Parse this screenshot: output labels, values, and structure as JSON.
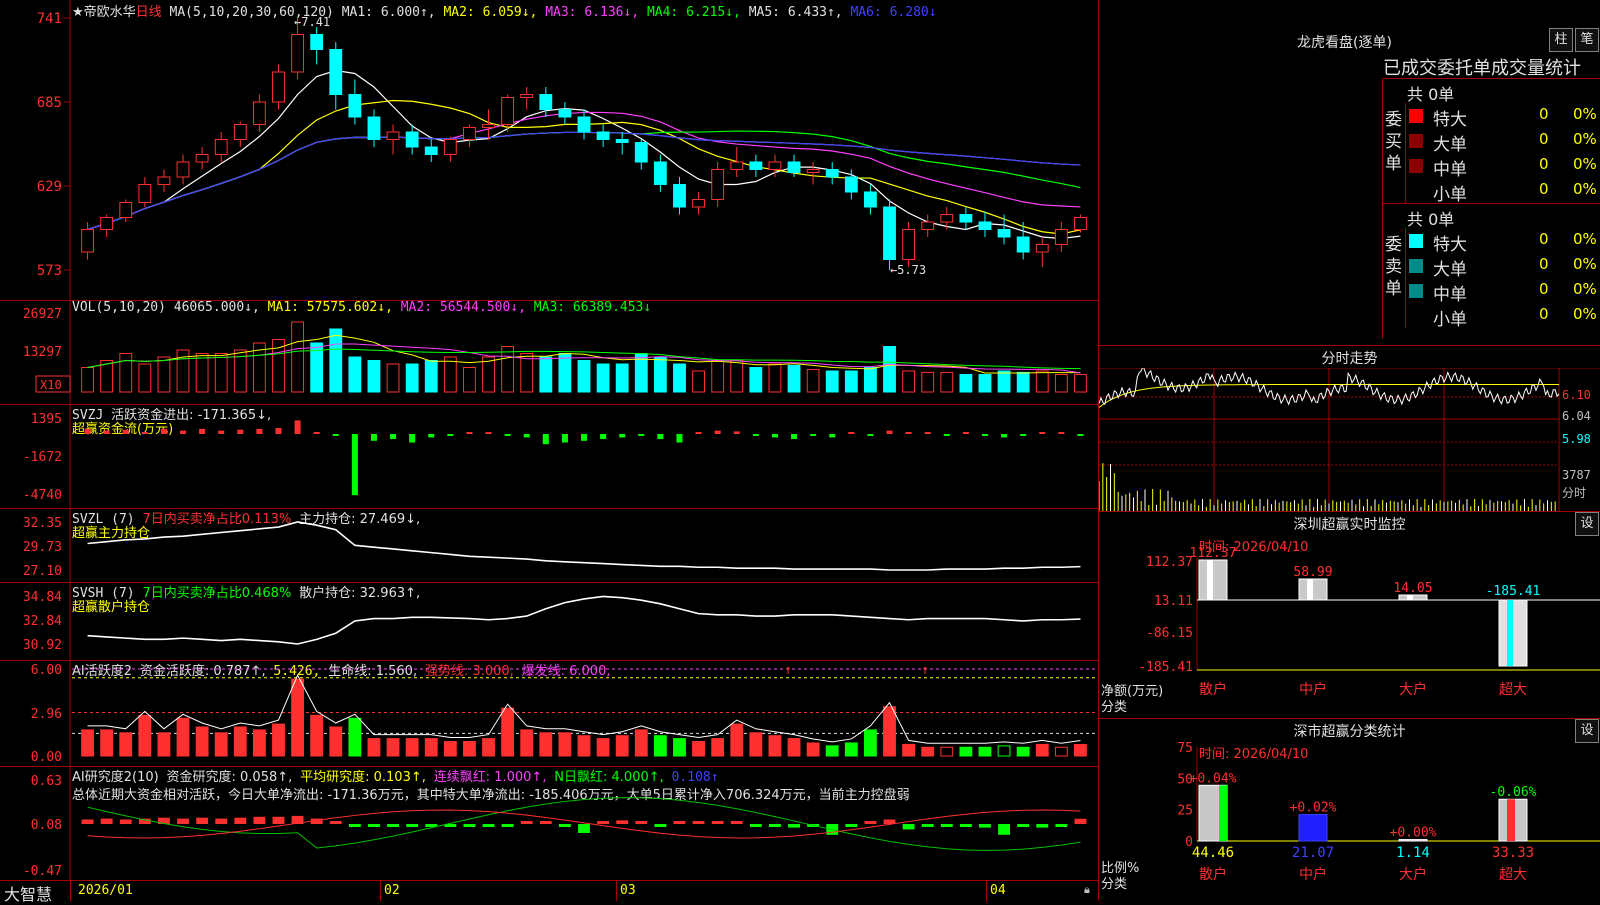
{
  "stock": {
    "name": "★帝欧水华",
    "period": "日线",
    "ma_text": "MA(5,10,20,30,60,120)",
    "ma1": "MA1: 6.000↑,",
    "ma2": "MA2: 6.059↓,",
    "ma3": "MA3: 6.136↓,",
    "ma4": "MA4: 6.215↓,",
    "ma5": "MA5: 6.433↑,",
    "ma6": "MA6: 6.280↓",
    "y_labels": [
      "7.41",
      "6.85",
      "6.29",
      "5.73"
    ],
    "high_label": "7.41",
    "low_label": "5.73"
  },
  "vol": {
    "title": "VOL(5,10,20)",
    "value": "46065.000↓,",
    "ma1": "MA1: 57575.602↓,",
    "ma2": "MA2: 56544.500↓,",
    "ma3": "MA3: 66389.453↓",
    "y_labels": [
      "26927",
      "13297"
    ],
    "unit": "X10"
  },
  "svzj": {
    "title": "SVZJ",
    "label": "活跃资金进出: -171.365↓,",
    "sub": "超赢资金流(万元)",
    "y_labels": [
      "1395",
      "-1672",
      "-4740"
    ]
  },
  "svzl": {
    "title": "SVZL (7)",
    "ratio": "7日内买卖净占比0.113%",
    "hold": "主力持仓: 27.469↓,",
    "sub": "超赢主力持仓",
    "y_labels": [
      "32.35",
      "29.73",
      "27.10"
    ]
  },
  "svsh": {
    "title": "SVSH (7)",
    "ratio": "7日内买卖净占比0.468%",
    "hold": "散户持仓: 32.963↑,",
    "sub": "超赢散户持仓",
    "y_labels": [
      "34.84",
      "32.84",
      "30.92"
    ]
  },
  "ai1": {
    "title": "AI活跃度2",
    "activity": "资金活跃度: 0.787↑,",
    "extra": "5.426,",
    "life": "生命线: 1.560,",
    "strong": "强势线: 3.000,",
    "burst": "爆发线: 6.000,",
    "y_labels": [
      "6.00",
      "2.96",
      "0.00"
    ]
  },
  "ai2": {
    "title": "AI研究度2(10)",
    "research": "资金研究度: 0.058↑,",
    "avg": "平均研究度: 0.103↑,",
    "streak": "连续飘红: 1.000↑,",
    "nday": "N日飘红: 4.000↑,",
    "last": "0.108↑",
    "summary": "总体近期大资金相对活跃，今日大单净流出: -171.36万元，其中特大单净流出: -185.406万元，大单5日累计净入706.324万元，当前主力控盘弱",
    "y_labels": [
      "0.63",
      "0.08",
      "-0.47"
    ]
  },
  "xaxis": {
    "logo": "大智慧",
    "labels": [
      "2026/01",
      "02",
      "03",
      "04"
    ]
  },
  "longhu": {
    "title": "龙虎看盘(逐单)",
    "btn1": "柱",
    "btn2": "笔",
    "subtitle": "已成交委托单成交量统计",
    "buy_label": "委买单",
    "sell_label": "委卖单",
    "buy_total": "共 0单",
    "sell_total": "共 0单",
    "rows": [
      {
        "name": "特大",
        "count": "0",
        "pct": "0%"
      },
      {
        "name": "大单",
        "count": "0",
        "pct": "0%"
      },
      {
        "name": "中单",
        "count": "0",
        "pct": "0%"
      },
      {
        "name": "小单",
        "count": "0",
        "pct": "0%"
      }
    ]
  },
  "fenshi": {
    "title": "分时走势",
    "y_labels": [
      "6.10",
      "6.04",
      "5.98"
    ],
    "vol_label": "3787",
    "vol_unit": "分时"
  },
  "monitor": {
    "title": "深圳超赢实时监控",
    "btn": "设",
    "time": "时间: 2026/04/10",
    "y_labels": [
      "112.37",
      "13.11",
      "-86.15",
      "-185.41"
    ],
    "unit_label": "净额(万元)",
    "cat_label": "分类",
    "categories": [
      "散户",
      "中户",
      "大户",
      "超大"
    ],
    "values": [
      "112.37",
      "58.99",
      "14.05",
      "-185.41"
    ]
  },
  "classify": {
    "title": "深市超赢分类统计",
    "btn": "设",
    "time": "时间: 2026/04/10",
    "y_labels": [
      "75",
      "50",
      "25",
      "0"
    ],
    "ratio_label": "比例%",
    "cat_label": "分类",
    "categories": [
      "散户",
      "中户",
      "大户",
      "超大"
    ],
    "changes": [
      "+0.04%",
      "+0.02%",
      "+0.00%",
      "-0.06%"
    ],
    "values": [
      "44.46",
      "21.07",
      "1.14",
      "33.33"
    ]
  },
  "chart_data": [
    {
      "type": "candlestick",
      "title": "帝欧水华 日线",
      "ylim": [
        5.73,
        7.41
      ],
      "x_labels": [
        "2026/01",
        "02",
        "03",
        "04"
      ],
      "ohlc": [
        [
          5.85,
          6.05,
          5.8,
          6.0
        ],
        [
          6.0,
          6.1,
          5.95,
          6.08
        ],
        [
          6.08,
          6.2,
          6.05,
          6.18
        ],
        [
          6.18,
          6.35,
          6.15,
          6.3
        ],
        [
          6.3,
          6.4,
          6.25,
          6.35
        ],
        [
          6.35,
          6.5,
          6.3,
          6.45
        ],
        [
          6.45,
          6.55,
          6.4,
          6.5
        ],
        [
          6.5,
          6.65,
          6.45,
          6.6
        ],
        [
          6.6,
          6.72,
          6.55,
          6.7
        ],
        [
          6.7,
          6.9,
          6.65,
          6.85
        ],
        [
          6.85,
          7.1,
          6.8,
          7.05
        ],
        [
          7.05,
          7.41,
          7.0,
          7.3
        ],
        [
          7.3,
          7.35,
          7.1,
          7.2
        ],
        [
          7.2,
          7.25,
          6.8,
          6.9
        ],
        [
          6.9,
          7.0,
          6.7,
          6.75
        ],
        [
          6.75,
          6.8,
          6.55,
          6.6
        ],
        [
          6.6,
          6.7,
          6.5,
          6.65
        ],
        [
          6.65,
          6.7,
          6.5,
          6.55
        ],
        [
          6.55,
          6.6,
          6.45,
          6.5
        ],
        [
          6.5,
          6.62,
          6.45,
          6.6
        ],
        [
          6.6,
          6.7,
          6.55,
          6.68
        ],
        [
          6.68,
          6.8,
          6.6,
          6.7
        ],
        [
          6.7,
          6.9,
          6.65,
          6.88
        ],
        [
          6.88,
          6.95,
          6.8,
          6.9
        ],
        [
          6.9,
          6.95,
          6.75,
          6.8
        ],
        [
          6.8,
          6.85,
          6.7,
          6.75
        ],
        [
          6.75,
          6.8,
          6.6,
          6.65
        ],
        [
          6.65,
          6.7,
          6.55,
          6.6
        ],
        [
          6.6,
          6.65,
          6.5,
          6.58
        ],
        [
          6.58,
          6.6,
          6.4,
          6.45
        ],
        [
          6.45,
          6.5,
          6.25,
          6.3
        ],
        [
          6.3,
          6.35,
          6.1,
          6.15
        ],
        [
          6.15,
          6.25,
          6.1,
          6.2
        ],
        [
          6.2,
          6.45,
          6.15,
          6.4
        ],
        [
          6.4,
          6.55,
          6.35,
          6.45
        ],
        [
          6.45,
          6.5,
          6.35,
          6.4
        ],
        [
          6.4,
          6.5,
          6.35,
          6.45
        ],
        [
          6.45,
          6.5,
          6.35,
          6.38
        ],
        [
          6.38,
          6.45,
          6.3,
          6.4
        ],
        [
          6.4,
          6.45,
          6.3,
          6.35
        ],
        [
          6.35,
          6.4,
          6.2,
          6.25
        ],
        [
          6.25,
          6.3,
          6.1,
          6.15
        ],
        [
          6.15,
          6.2,
          5.73,
          5.8
        ],
        [
          5.8,
          6.05,
          5.75,
          6.0
        ],
        [
          6.0,
          6.1,
          5.95,
          6.05
        ],
        [
          6.05,
          6.15,
          6.0,
          6.1
        ],
        [
          6.1,
          6.15,
          6.0,
          6.05
        ],
        [
          6.05,
          6.12,
          5.95,
          6.0
        ],
        [
          6.0,
          6.1,
          5.9,
          5.95
        ],
        [
          5.95,
          6.05,
          5.8,
          5.85
        ],
        [
          5.85,
          5.95,
          5.75,
          5.9
        ],
        [
          5.9,
          6.05,
          5.85,
          6.0
        ],
        [
          6.0,
          6.1,
          5.98,
          6.08
        ]
      ]
    }
  ]
}
